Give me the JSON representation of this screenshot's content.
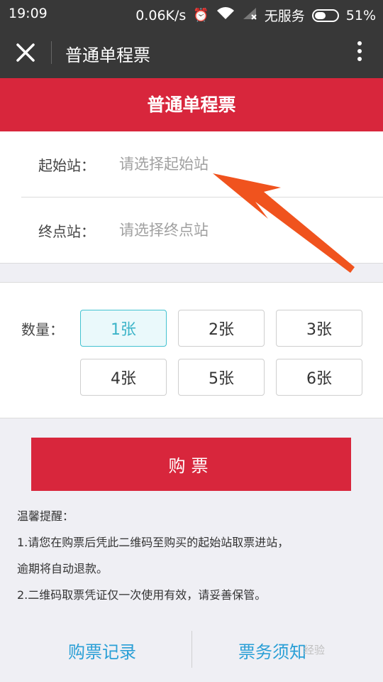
{
  "status": {
    "time": "19:09",
    "net_speed": "0.06K/s",
    "carrier": "无服务",
    "battery_percent": "51%",
    "battery_level": 0.51
  },
  "nav": {
    "title": "普通单程票"
  },
  "banner": {
    "title": "普通单程票"
  },
  "stations": {
    "start_label": "起始站：",
    "start_placeholder": "请选择起始站",
    "end_label": "终点站：",
    "end_placeholder": "请选择终点站"
  },
  "quantity": {
    "label": "数量：",
    "options": [
      "1张",
      "2张",
      "3张",
      "4张",
      "5张",
      "6张"
    ],
    "selected_index": 0
  },
  "buy_button": "购票",
  "notice": {
    "title": "温馨提醒：",
    "line1": "1.请您在购票后凭此二维码至购买的起始站取票进站，",
    "line2": "逾期将自动退款。",
    "line3": "2.二维码取票凭证仅一次使用有效，请妥善保管。"
  },
  "links": {
    "records": "购票记录",
    "guide": "票务须知"
  },
  "watermark": "经验",
  "colors": {
    "accent_red": "#d8263c",
    "link_blue": "#2a9fd6",
    "selected_cyan": "#43c2d0",
    "arrow_orange": "#f0531e"
  }
}
